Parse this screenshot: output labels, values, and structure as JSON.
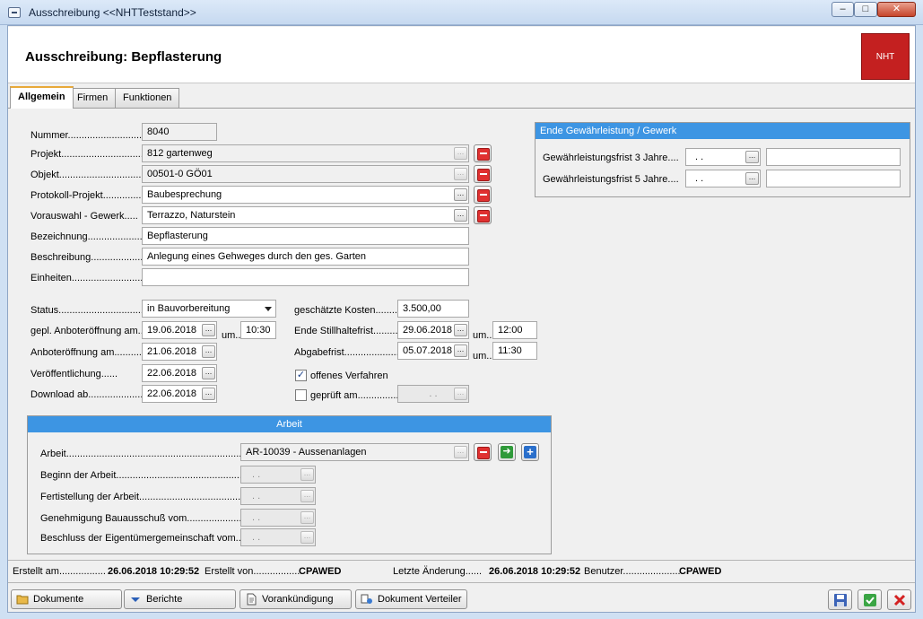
{
  "window": {
    "title": "Ausschreibung  <<NHTTeststand>>",
    "min": "–",
    "max": "□",
    "close": "✕"
  },
  "header": {
    "title": "Ausschreibung: Bepflasterung",
    "logo": "NHT"
  },
  "tabs": [
    {
      "label": "Allgemein"
    },
    {
      "label": "Firmen"
    },
    {
      "label": "Funktionen"
    }
  ],
  "form": {
    "nummer": {
      "label": "Nummer.............................",
      "value": "8040"
    },
    "projekt": {
      "label": "Projekt..............................",
      "value": "812 gartenweg"
    },
    "objekt": {
      "label": "Objekt...............................",
      "value": "00501-0 GÖ01"
    },
    "protokoll": {
      "label": "Protokoll-Projekt..................",
      "value": "Baubesprechung"
    },
    "vorauswahl": {
      "label": "Vorauswahl - Gewerk.....",
      "value": "Terrazzo, Naturstein"
    },
    "bezeichnung": {
      "label": "Bezeichnung.....................",
      "value": "Bepflasterung"
    },
    "beschreibung": {
      "label": "Beschreibung....................",
      "value": "Anlegung eines Gehweges durch den ges. Garten"
    },
    "einheiten": {
      "label": "Einheiten...........................",
      "value": ""
    },
    "status": {
      "label": "Status..................................",
      "value": "in Bauvorbereitung"
    },
    "gepl": {
      "label": "gepl. Anboteröffnung am..",
      "date": "19.06.2018",
      "um": "um..",
      "time": "10:30"
    },
    "anbot": {
      "label": "Anboteröffnung am..........",
      "date": "21.06.2018"
    },
    "veroeff": {
      "label": "Veröffentlichung......",
      "date": "22.06.2018"
    },
    "download": {
      "label": "Download ab.....................",
      "date": "22.06.2018"
    },
    "kosten": {
      "label": "geschätzte Kosten.........",
      "value": "3.500,00"
    },
    "stillhalte": {
      "label": "Ende Stillhaltefrist...........",
      "date": "29.06.2018",
      "um": "um..",
      "time": "12:00"
    },
    "abgabe": {
      "label": "Abgabefrist........................",
      "date": "05.07.2018",
      "um": "um..",
      "time": "11:30"
    },
    "offen": {
      "label": "offenes Verfahren",
      "checked": true
    },
    "geprueft": {
      "label": "geprüft am...............",
      "date": ". ."
    }
  },
  "gewaehr": {
    "title": "Ende Gewährleistung / Gewerk",
    "rows": [
      {
        "label": "Gewährleistungsfrist 3 Jahre....",
        "date": ". .",
        "note": ""
      },
      {
        "label": "Gewährleistungsfrist 5 Jahre....",
        "date": ". .",
        "note": ""
      }
    ]
  },
  "arbeit": {
    "title": "Arbeit",
    "label": "Arbeit.....................................................................................",
    "value": "AR-10039 - Aussenanlagen",
    "rows": [
      {
        "label": "Beginn der Arbeit.....................................................",
        "date": ". ."
      },
      {
        "label": "Fertistellung der Arbeit................................................",
        "date": ". ."
      },
      {
        "label": "Genehmigung Bauausschuß vom........................",
        "date": ". ."
      },
      {
        "label": "Beschluss der Eigentümergemeinschaft vom....",
        "date": ". ."
      }
    ]
  },
  "footer": {
    "erstellt_am_label": "Erstellt am.................",
    "erstellt_am": "26.06.2018 10:29:52",
    "erstellt_von_label": "Erstellt von..................",
    "erstellt_von": "CPAWED",
    "aenderung_label": "Letzte Änderung......",
    "aenderung": "26.06.2018 10:29:52",
    "benutzer_label": "Benutzer......................",
    "benutzer": "CPAWED"
  },
  "buttons": {
    "dokumente": "Dokumente",
    "berichte": "Berichte",
    "vorankuendigung": "Vorankündigung",
    "verteiler": "Dokument Verteiler"
  },
  "dots": "..."
}
